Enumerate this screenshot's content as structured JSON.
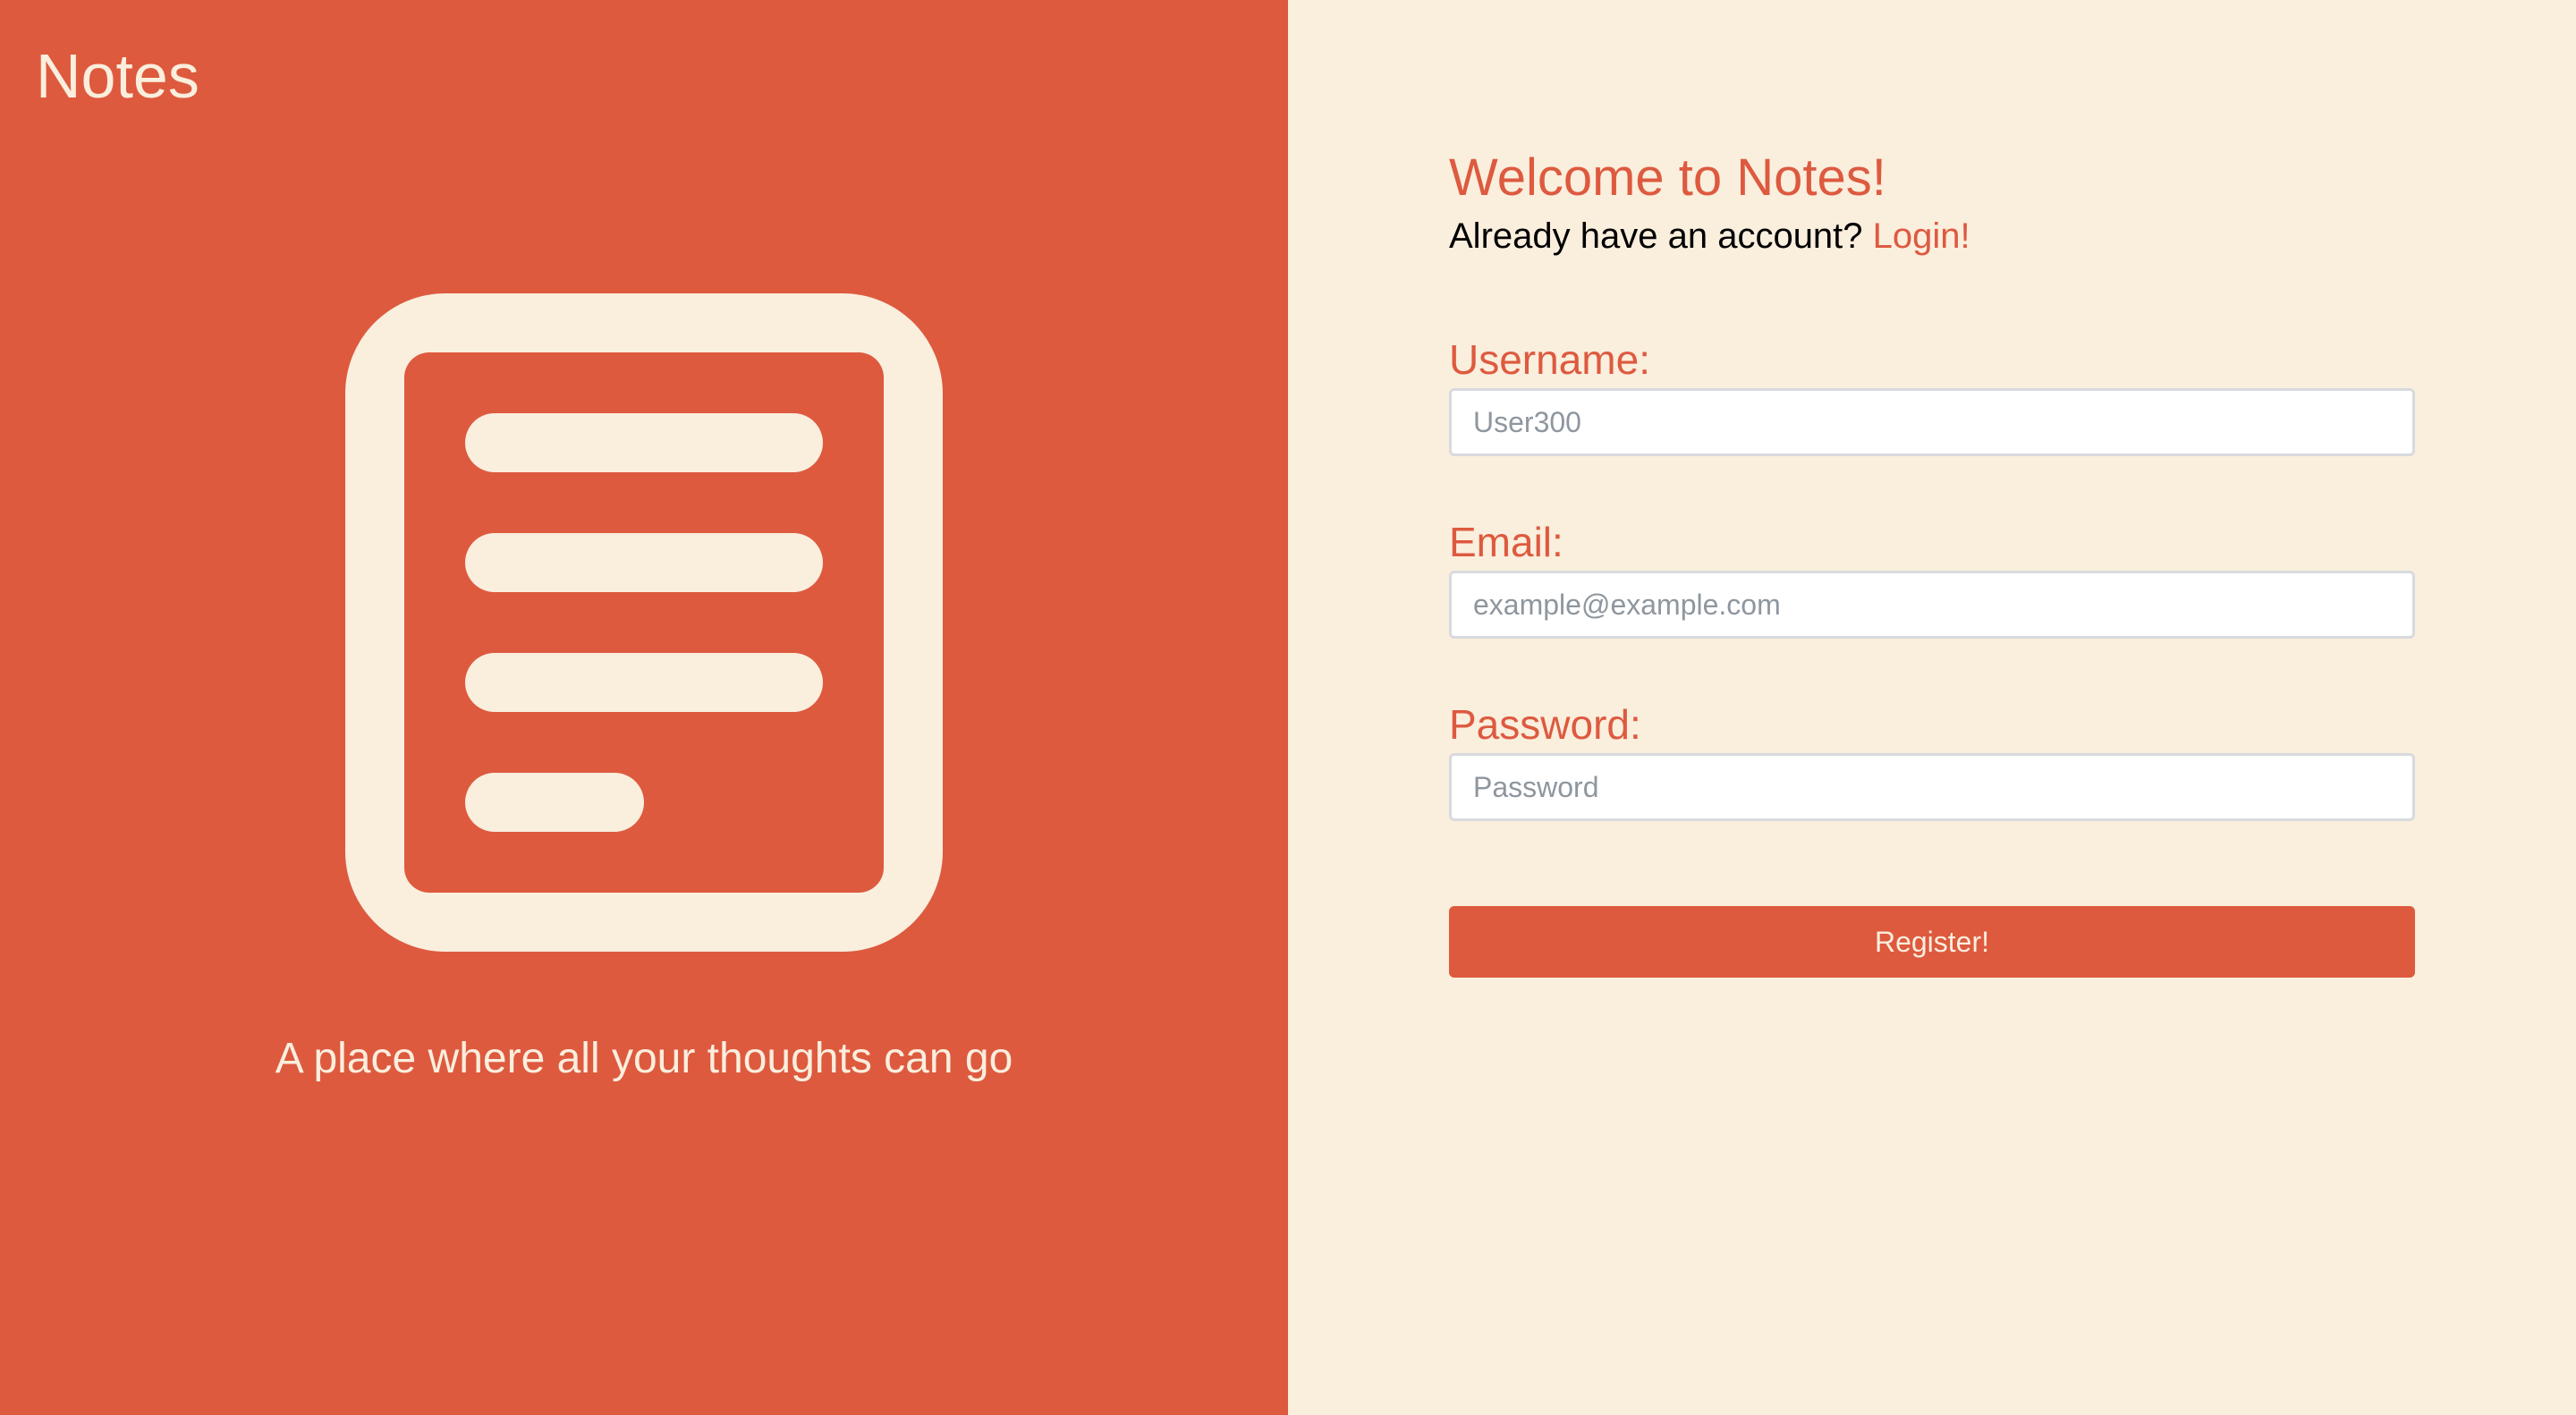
{
  "colors": {
    "accent": "#dd5a3f",
    "cream": "#faeedd",
    "input_border": "#d8dadd",
    "placeholder": "#8e969e",
    "text_dark": "#000000"
  },
  "brand": {
    "title": "Notes",
    "logo_icon": "notes-document-icon",
    "tagline": "A place where all your thoughts can go"
  },
  "register": {
    "heading": "Welcome to Notes!",
    "account_prompt": "Already have an account?",
    "login_link": "Login!",
    "fields": {
      "username": {
        "label": "Username:",
        "value": "",
        "placeholder": "User300"
      },
      "email": {
        "label": "Email:",
        "value": "",
        "placeholder": "example@example.com"
      },
      "password": {
        "label": "Password:",
        "value": "",
        "placeholder": "Password"
      }
    },
    "submit_label": "Register!"
  }
}
